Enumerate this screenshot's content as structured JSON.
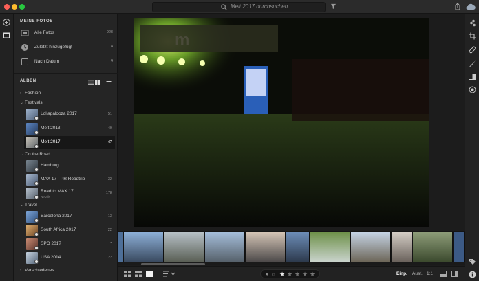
{
  "search": {
    "placeholder": "Melt 2017 durchsuchen"
  },
  "meine_fotos": {
    "title": "MEINE FOTOS",
    "items": [
      {
        "label": "Alle Fotos",
        "count": "923",
        "icon": "all-photos-icon"
      },
      {
        "label": "Zuletzt hinzugefügt",
        "count": "4",
        "icon": "clock-icon"
      },
      {
        "label": "Nach Datum",
        "count": "4",
        "icon": "calendar-icon"
      }
    ]
  },
  "alben": {
    "title": "ALBEN",
    "folders": [
      {
        "label": "Fashion",
        "expanded": false,
        "albums": []
      },
      {
        "label": "Festivals",
        "expanded": true,
        "albums": [
          {
            "label": "Lollapalooza 2017",
            "count": "51",
            "thumb": "#6b7f9a",
            "selected": false
          },
          {
            "label": "Melt 2013",
            "count": "40",
            "thumb": "#4d6d95",
            "selected": false
          },
          {
            "label": "Melt 2017",
            "count": "47",
            "thumb": "#8a8f8c",
            "selected": true
          }
        ]
      },
      {
        "label": "On the Road",
        "expanded": true,
        "albums": [
          {
            "label": "Hamburg",
            "count": "1",
            "thumb": "#4a5560",
            "selected": false
          },
          {
            "label": "MAX 17 - PR Roadtrip",
            "count": "32",
            "thumb": "#7a8ca6",
            "selected": false
          },
          {
            "label": "Road to MAX 17",
            "sub": "Netzlik",
            "count": "178",
            "thumb": "#8b95a3",
            "selected": false
          }
        ]
      },
      {
        "label": "Travel",
        "expanded": true,
        "albums": [
          {
            "label": "Barcelona 2017",
            "count": "13",
            "thumb": "#5e86b8",
            "selected": false
          },
          {
            "label": "South Africa 2017",
            "count": "22",
            "thumb": "#b07a55",
            "selected": false
          },
          {
            "label": "SPO 2017",
            "count": "7",
            "thumb": "#9a6a5a",
            "selected": false
          },
          {
            "label": "USA 2014",
            "count": "22",
            "thumb": "#8ea1b5",
            "selected": false
          }
        ]
      },
      {
        "label": "Verschiedenes",
        "expanded": false,
        "albums": []
      }
    ]
  },
  "bottombar": {
    "rating_stars": 1,
    "fit_label": "Einp.",
    "fill_label": "Ausf.",
    "ratio_label": "1:1"
  },
  "filmstrip": {
    "thumbs": [
      "#4e6f98",
      "#9aa5ad",
      "#87a1c0",
      "#a29aa0",
      "#6a85a8",
      "#5c7a43",
      "#a5b8cc",
      "#b9aba3",
      "#7b8a6a",
      "#3c5a85"
    ]
  },
  "colors": {
    "accent": "#ffffff",
    "selection": "#171717"
  }
}
